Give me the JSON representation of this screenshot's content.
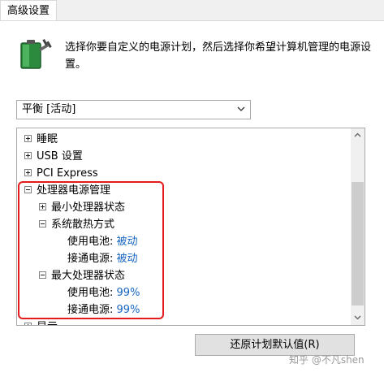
{
  "tab": {
    "title": "高级设置"
  },
  "description": "选择你要自定义的电源计划，然后选择你希望计算机管理的电源设置。",
  "plan_select": {
    "value": "平衡 [活动]"
  },
  "tree": {
    "items": [
      {
        "label": "睡眠",
        "expander": "plus"
      },
      {
        "label": "USB 设置",
        "expander": "plus"
      },
      {
        "label": "PCI Express",
        "expander": "plus"
      },
      {
        "label": "处理器电源管理",
        "expander": "minus"
      },
      {
        "label": "最小处理器状态",
        "expander": "plus"
      },
      {
        "label": "系统散热方式",
        "expander": "minus"
      },
      {
        "label": "使用电池:",
        "value": "被动"
      },
      {
        "label": "接通电源:",
        "value": "被动"
      },
      {
        "label": "最大处理器状态",
        "expander": "minus"
      },
      {
        "label": "使用电池:",
        "value": "99%"
      },
      {
        "label": "接通电源:",
        "value": "99%"
      },
      {
        "label": "显示",
        "expander": "plus"
      }
    ]
  },
  "restore_button": {
    "label": "还原计划默认值(R)"
  },
  "watermark": "知乎 @不凡shen",
  "colors": {
    "highlight": "#e41b1b",
    "value_text": "#1665c0",
    "panel_bg": "#ffffff",
    "window_bg": "#f0f0f0"
  }
}
